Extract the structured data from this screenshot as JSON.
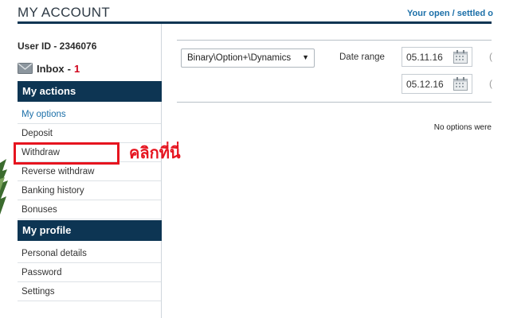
{
  "header": {
    "title": "MY ACCOUNT",
    "open_settled_link": "Your open / settled o"
  },
  "sidebar": {
    "user_id": "User ID - 2346076",
    "inbox_label": "Inbox",
    "inbox_separator": "-",
    "inbox_count": "1",
    "actions_heading": "My actions",
    "actions": [
      "My options",
      "Deposit",
      "Withdraw",
      "Reverse withdraw",
      "Banking history",
      "Bonuses"
    ],
    "profile_heading": "My profile",
    "profile": [
      "Personal details",
      "Password",
      "Settings"
    ]
  },
  "annotation": {
    "text": "คลิกที่นี่"
  },
  "main": {
    "market_select_value": "Binary\\Option+\\Dynamics",
    "date_range_label": "Date range",
    "date_from": "05.11.16",
    "date_to": "05.12.16",
    "cut_off_char": "(",
    "no_options_text": "No options were"
  },
  "colors": {
    "header_bar": "#0d3553",
    "link": "#1b6fa8",
    "annotation": "#e6141f",
    "inbox_count": "#d0021b"
  }
}
